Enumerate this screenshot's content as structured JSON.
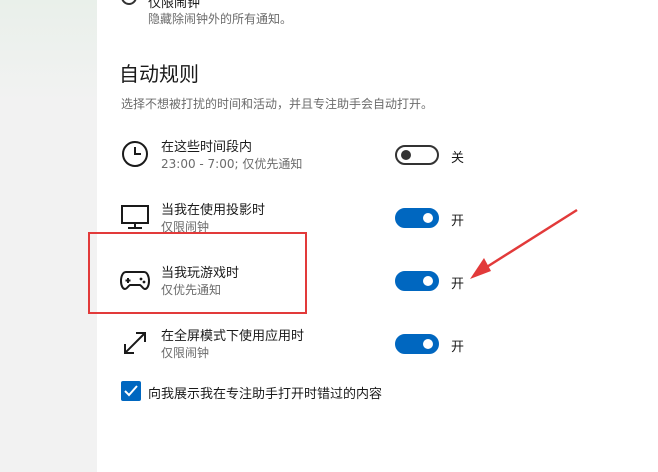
{
  "top_option": {
    "label": "仅限闹钟",
    "description": "隐藏除闹钟外的所有通知。"
  },
  "section": {
    "title": "自动规则",
    "description": "选择不想被打扰的时间和活动，并且专注助手会自动打开。"
  },
  "rules": [
    {
      "title": "在这些时间段内",
      "subtitle": "23:00 - 7:00; 仅优先通知",
      "state": "关",
      "on": false,
      "icon": "clock-icon"
    },
    {
      "title": "当我在使用投影时",
      "subtitle": "仅限闹钟",
      "state": "开",
      "on": true,
      "icon": "monitor-icon"
    },
    {
      "title": "当我玩游戏时",
      "subtitle": "仅优先通知",
      "state": "开",
      "on": true,
      "icon": "gamepad-icon"
    },
    {
      "title": "在全屏模式下使用应用时",
      "subtitle": "仅限闹钟",
      "state": "开",
      "on": true,
      "icon": "expand-arrows-icon"
    }
  ],
  "checkbox": {
    "label": "向我展示我在专注助手打开时错过的内容",
    "checked": true
  },
  "colors": {
    "accent": "#0067c0",
    "annotation_red": "#e23a3a"
  }
}
